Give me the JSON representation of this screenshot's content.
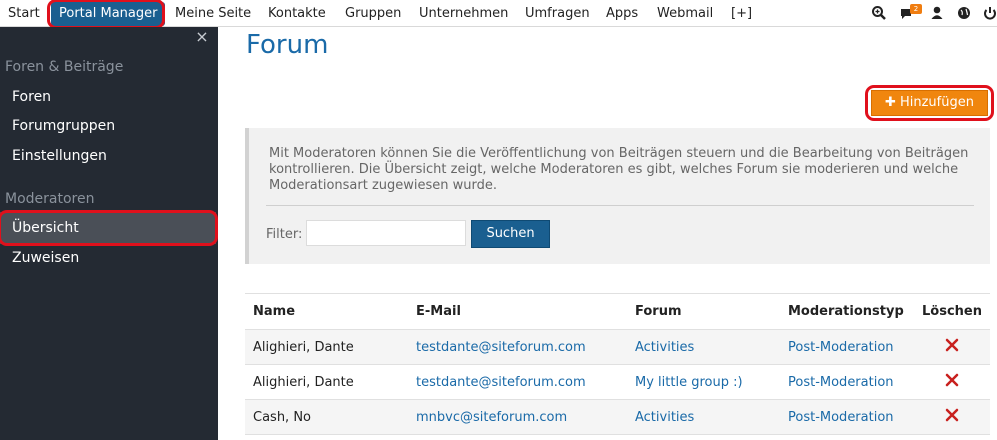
{
  "topnav": {
    "items": [
      "Start",
      "Portal Manager",
      "Meine Seite",
      "Kontakte",
      "Gruppen",
      "Unternehmen",
      "Umfragen",
      "Apps",
      "Webmail",
      "[+]"
    ],
    "notification_count": "2",
    "icons": [
      "search-icon",
      "messages-icon",
      "user-icon",
      "globe-icon",
      "power-icon"
    ]
  },
  "sidebar": {
    "sections": [
      {
        "label": "Foren & Beiträge",
        "items": [
          "Foren",
          "Forumgruppen",
          "Einstellungen"
        ]
      },
      {
        "label": "Moderatoren",
        "items": [
          "Übersicht",
          "Zuweisen"
        ]
      }
    ],
    "close_glyph": "×"
  },
  "main": {
    "title": "Forum",
    "add_button": "Hinzufügen",
    "info_text": "Mit Moderatoren können Sie die Veröffentlichung von Beiträgen steuern und die Bearbeitung von Beiträgen kontrollieren. Die Übersicht zeigt, welche Moderatoren es gibt, welches Forum sie moderieren und welche Moderationsart zugewiesen wurde.",
    "filter_label": "Filter:",
    "filter_value": "",
    "search_button": "Suchen",
    "table": {
      "columns": [
        "Name",
        "E-Mail",
        "Forum",
        "Moderationstyp",
        "Löschen"
      ],
      "rows": [
        [
          "Alighieri, Dante",
          "testdante@siteforum.com",
          "Activities",
          "Post-Moderation"
        ],
        [
          "Alighieri, Dante",
          "testdante@siteforum.com",
          "My little group :)",
          "Post-Moderation"
        ],
        [
          "Cash, No",
          "mnbvc@siteforum.com",
          "Activities",
          "Post-Moderation"
        ]
      ]
    }
  },
  "colors": {
    "brand_blue": "#1a5f90",
    "accent_orange": "#f0860e",
    "sidebar_bg": "#242a33",
    "highlight_red": "#e0101c",
    "delete_red": "#c8201e"
  }
}
